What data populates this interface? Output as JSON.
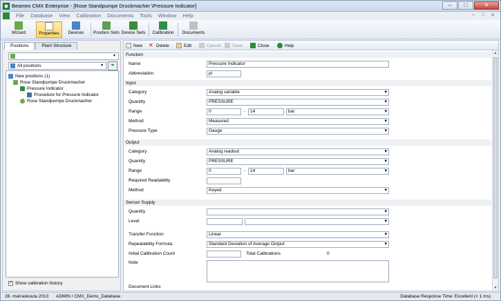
{
  "window": {
    "title": "Beamex CMX Enterprise - [Rose Standpumpe Druckmacher \\Pressure Indicator]",
    "min": "–",
    "max": "□",
    "close": "✕"
  },
  "menu": {
    "items": [
      "File",
      "Database",
      "View",
      "Calibration",
      "Documents",
      "Tools",
      "Window",
      "Help"
    ],
    "mdi": [
      "–",
      "□",
      "✕"
    ]
  },
  "toolbar": {
    "wizard": "Wizard",
    "properties": "Properties",
    "devices": "Devices",
    "position_sets": "Position Sets",
    "device_sets": "Device Sets",
    "calibration": "Calibration",
    "documents": "Documents"
  },
  "left": {
    "tabs": [
      "Positions",
      "Plant Structure"
    ],
    "filter": "All positions",
    "tree": [
      "New positions (1)",
      "Rose Standpumpe Druckmacher",
      "Pressure Indicator",
      "Procedure for Pressure Indicator",
      "Rose Standpumpe Druckmacher"
    ],
    "show_history": "Show calibration history"
  },
  "right_toolbar": {
    "new": "New",
    "delete": "Delete",
    "edit": "Edit",
    "cancel": "Cancel",
    "save": "Save",
    "close": "Close",
    "help": "Help"
  },
  "form": {
    "function_header": "Function",
    "name_label": "Name",
    "name_value": "Pressure Indicator",
    "abbrev_label": "Abbreviation",
    "abbrev_value": "pi",
    "input_header": "Input",
    "in_category_label": "Category",
    "in_category": "Analog variable",
    "in_quantity_label": "Quantity",
    "in_quantity": "PRESSURE",
    "in_range_label": "Range",
    "in_range_min": "0",
    "in_range_max": "14",
    "in_unit": "bar",
    "in_method_label": "Method",
    "in_method": "Measured",
    "pressure_type_label": "Pressure Type",
    "pressure_type": "Gauge",
    "output_header": "Output",
    "out_category_label": "Category",
    "out_category": "Analog readout",
    "out_quantity_label": "Quantity",
    "out_quantity": "PRESSURE",
    "out_range_label": "Range",
    "out_range_min": "0",
    "out_range_max": "14",
    "out_unit": "bar",
    "req_read_label": "Required Readability",
    "out_method_label": "Method",
    "out_method": "Keyed",
    "sensor_header": "Sensor Supply",
    "sensor_quantity_label": "Quantity",
    "sensor_level_label": "Level",
    "transfer_label": "Transfer Function",
    "transfer": "Linear",
    "repeat_label": "Repeatability Formula",
    "repeat": "Standard Deviation of Average Output",
    "init_cal_label": "Initial Calibration Count",
    "total_cal_label": "Total Calibrations",
    "total_cal": "0",
    "note_label": "Note",
    "doc_links_label": "Document Links",
    "dash": "-"
  },
  "status": {
    "date": "28. marraskuuta 2013",
    "user": "ADMIN / CMX_Demo_Database",
    "response": "Database Response Time: Excellent (< 1 ms)"
  }
}
